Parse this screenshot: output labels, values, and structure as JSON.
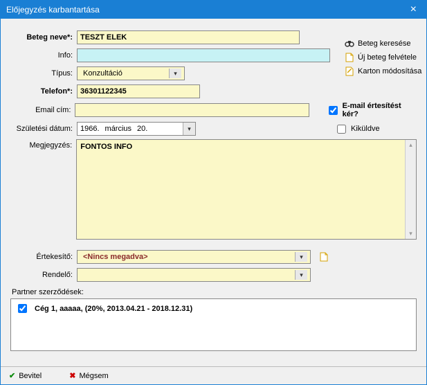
{
  "window": {
    "title": "Előjegyzés karbantartása"
  },
  "labels": {
    "patient_name": "Beteg neve*:",
    "info": "Info:",
    "type": "Típus:",
    "phone": "Telefon*:",
    "email": "Email cím:",
    "birthdate": "Születési dátum:",
    "note": "Megjegyzés:",
    "seller": "Értekesítő:",
    "office": "Rendelő:",
    "partners": "Partner szerződések:"
  },
  "fields": {
    "patient_name": "TESZT ELEK",
    "info": "",
    "type_selected": "Konzultáció",
    "phone": "36301122345",
    "email": "",
    "birth_year": "1966.",
    "birth_month": "március",
    "birth_day": "20.",
    "note": "FONTOS INFO",
    "seller_selected": "<Nincs megadva>",
    "office_selected": ""
  },
  "checks": {
    "email_notify_label": "E-mail értesítést kér?",
    "email_notify_checked": true,
    "sent_label": "Kiküldve",
    "sent_checked": false
  },
  "actions": {
    "search": "Beteg keresése",
    "new_patient": "Új beteg felvétele",
    "edit_card": "Karton módosítása"
  },
  "partners": [
    {
      "checked": true,
      "text": "Cég 1, aaaaa,  (20%, 2013.04.21 - 2018.12.31)"
    }
  ],
  "footer": {
    "ok": "Bevitel",
    "cancel": "Mégsem"
  },
  "icons": {
    "binoculars": "🔍",
    "new_page": "📄",
    "edit_page": "📝",
    "page": "📄",
    "check": "✔",
    "cross": "✖",
    "dropdown": "▾",
    "calendar": "▾",
    "scroll_up": "▴",
    "scroll_down": "▾"
  },
  "colors": {
    "titlebar": "#1a7fd4",
    "field_bg": "#fbf8c8",
    "info_bg": "#c7f2f5"
  }
}
